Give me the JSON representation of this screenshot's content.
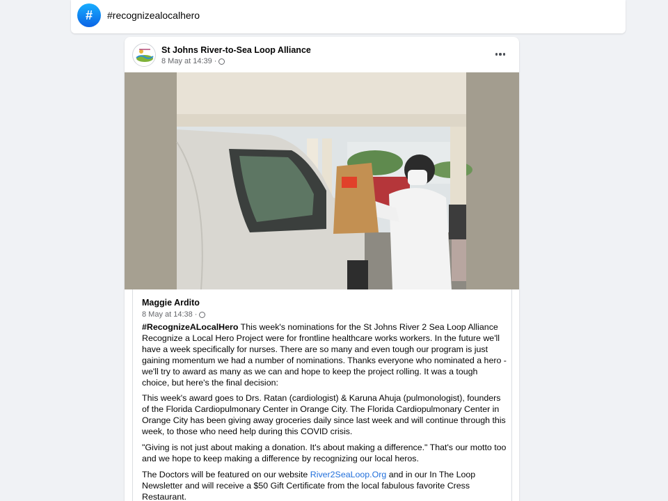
{
  "hashtag_header": {
    "icon_glyph": "#",
    "title": "#recognizealocalhero"
  },
  "post": {
    "page_name": "St Johns River-to-Sea Loop Alliance",
    "timestamp": "8 May at 14:39",
    "separator": "·",
    "audience_icon": "globe-icon",
    "more_icon": "more-options-icon"
  },
  "shared": {
    "author": "Maggie Ardito",
    "timestamp": "8 May at 14:38",
    "separator": "·",
    "hashtag": "#RecognizeALocalHero",
    "p1_rest": "  This week's nominations for the St Johns River 2 Sea Loop Alliance Recognize a Local Hero Project were for frontline healthcare works workers.  In the future we'll have a week specifically for nurses.  There are so many and even tough our program is just gaining momentum we had a number of nominations.  Thanks everyone who nominated a hero - we'll try to award as many as we can and hope to keep the project rolling.  It was a tough choice, but here's the final decision:",
    "p2": "This week's award goes to Drs. Ratan (cardiologist) & Karuna Ahuja (pulmonologist), founders of the Florida Cardiopulmonary Center in Orange City. The Florida Cardiopulmonary Center in Orange City has been giving away groceries daily since last week and will continue through this week, to those who need help during this COVID crisis.",
    "p3": "\"Giving is not just about making a donation. It's about making a difference.\" That's our motto too and we hope to keep making a difference by recognizing our local heros.",
    "p4_before": "The Doctors will be featured on our website ",
    "p4_link": "River2SeaLoop.Org",
    "p4_after": " and in our In The Loop Newsletter and will receive a $50 Gift Certificate from the local fabulous favorite Cress Restaurant."
  },
  "colors": {
    "page_background": "#f0f2f5",
    "hashtag_blue": "#0a63e5",
    "link_blue": "#216fdb",
    "meta_gray": "#65676b"
  }
}
